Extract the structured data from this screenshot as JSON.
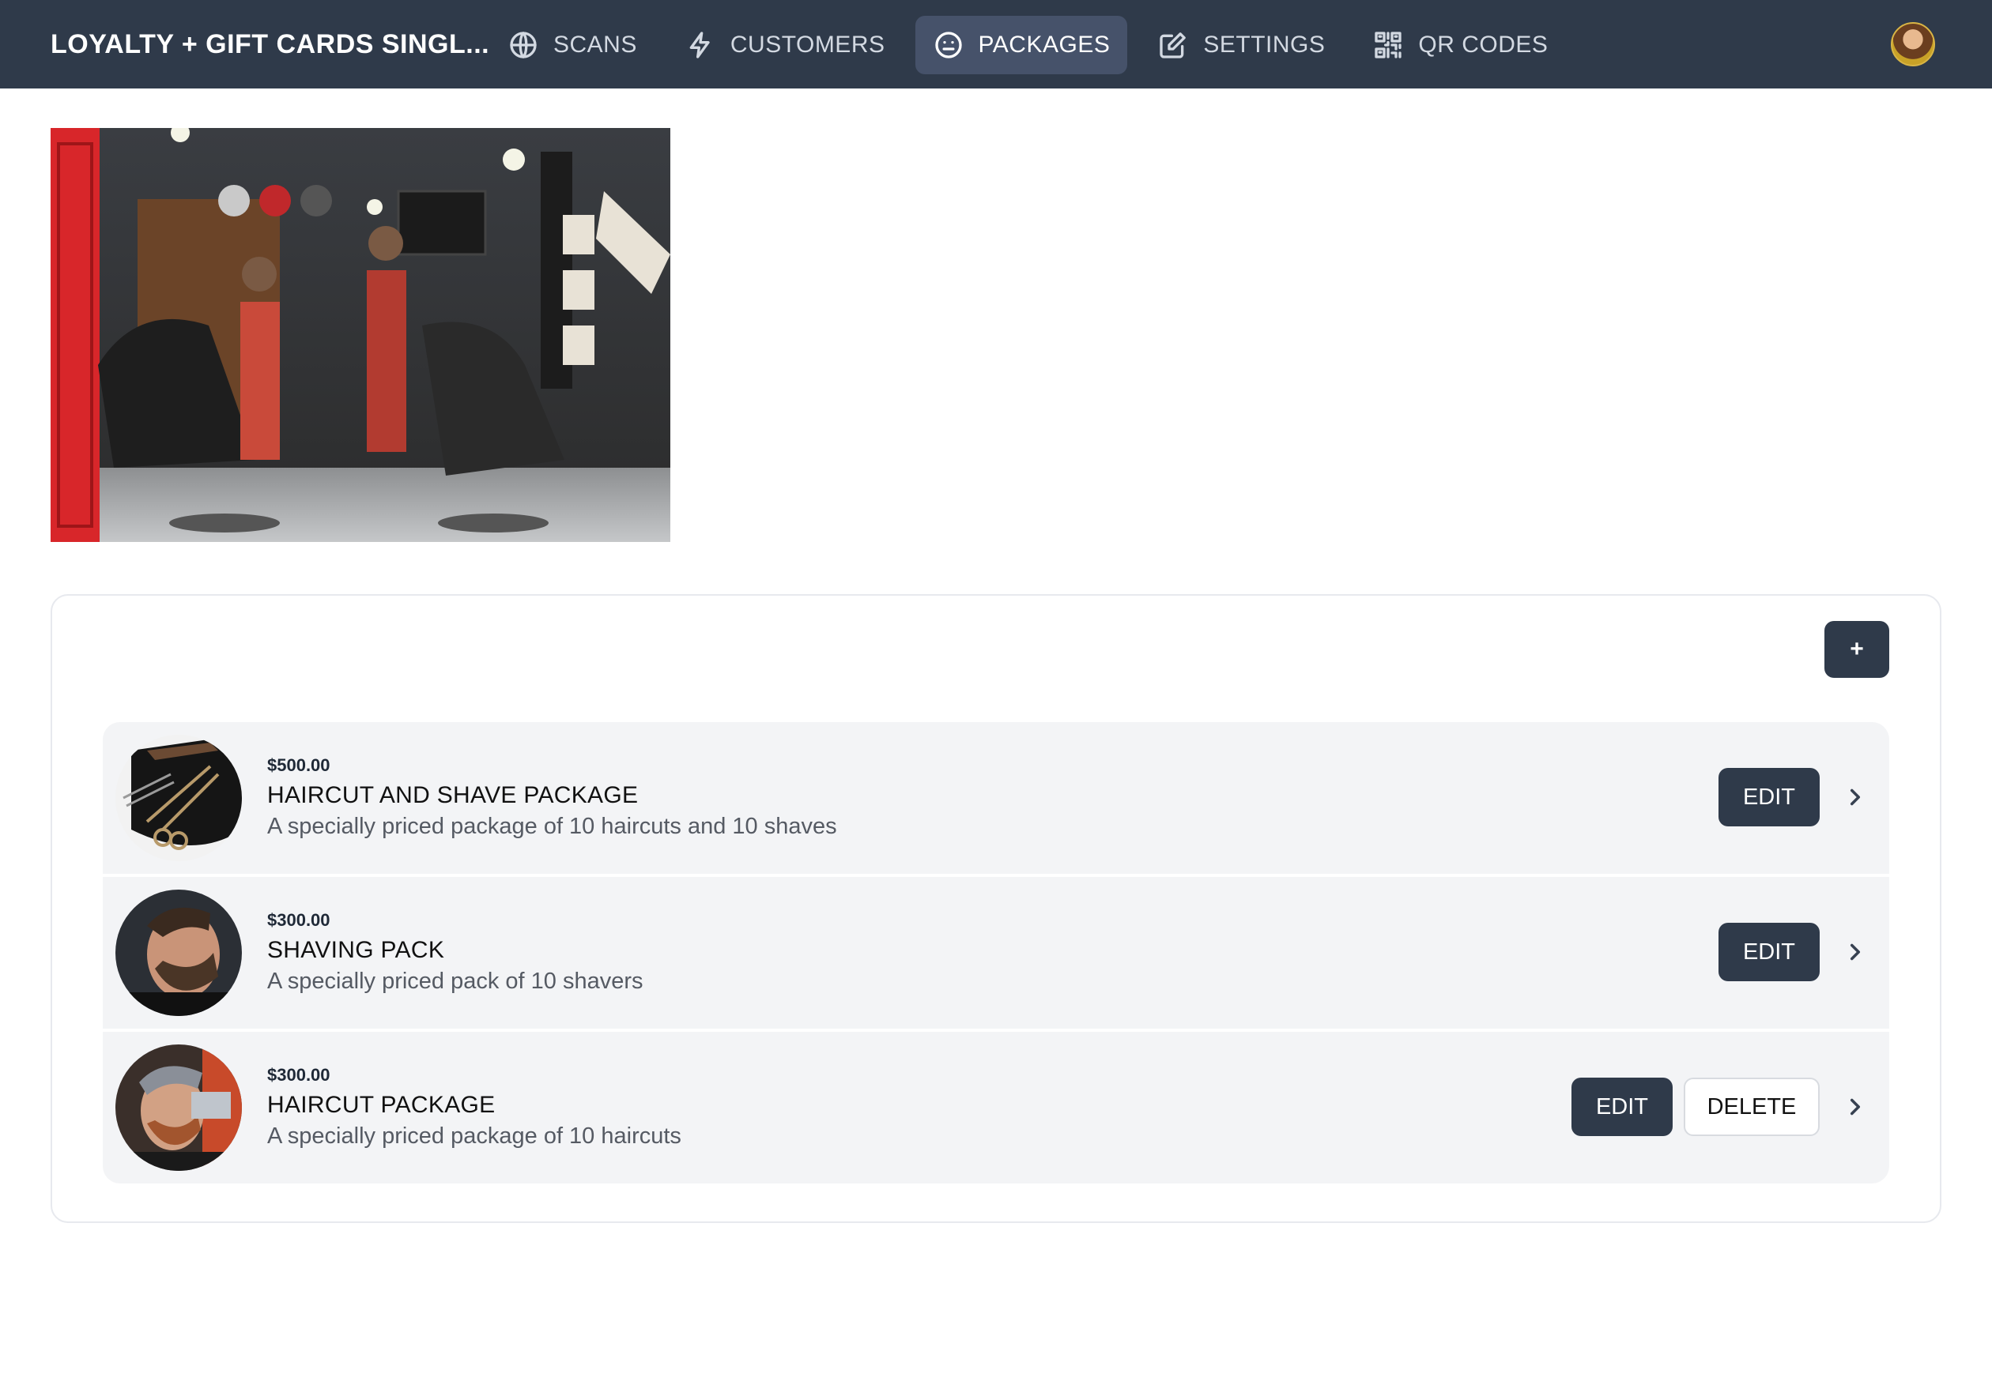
{
  "header": {
    "brand": "LOYALTY + GIFT CARDS SINGL...",
    "nav": [
      {
        "label": "SCANS",
        "icon": "globe-icon"
      },
      {
        "label": "CUSTOMERS",
        "icon": "bolt-icon"
      },
      {
        "label": "PACKAGES",
        "icon": "face-icon",
        "active": true
      },
      {
        "label": "SETTINGS",
        "icon": "edit-icon"
      },
      {
        "label": "QR CODES",
        "icon": "qr-code-icon"
      }
    ]
  },
  "actions": {
    "add_label": "+"
  },
  "packages": [
    {
      "price": "$500.00",
      "title": "HAIRCUT AND SHAVE PACKAGE",
      "description": "A specially priced package of 10 haircuts and 10 shaves",
      "edit_label": "EDIT"
    },
    {
      "price": "$300.00",
      "title": "SHAVING PACK",
      "description": "A specially priced pack of 10 shavers",
      "edit_label": "EDIT"
    },
    {
      "price": "$300.00",
      "title": "HAIRCUT PACKAGE",
      "description": "A specially priced package of 10 haircuts",
      "edit_label": "EDIT",
      "delete_label": "DELETE"
    }
  ],
  "colors": {
    "nav_bg": "#2f3a4a",
    "nav_active": "#46526a",
    "button_dark": "#2f3a4a",
    "row_bg": "#f3f4f6"
  }
}
